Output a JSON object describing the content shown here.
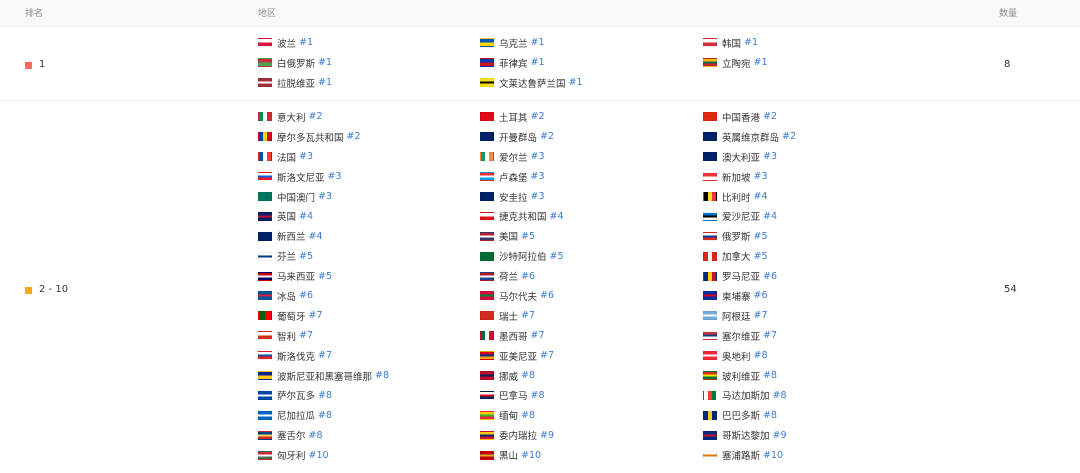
{
  "header": {
    "rank": "排名",
    "region": "地区",
    "count": "数量"
  },
  "groups": [
    {
      "rank_label": "1",
      "count": "8",
      "color": "#f26b5b",
      "regions": [
        {
          "name": "波兰",
          "rank": "#1",
          "flag": [
            "#ffffff",
            "#dc143c"
          ]
        },
        {
          "name": "乌克兰",
          "rank": "#1",
          "flag": [
            "#0057b7",
            "#ffd700"
          ]
        },
        {
          "name": "韩国",
          "rank": "#1",
          "flag": [
            "#ffffff",
            "#cd2e3a"
          ]
        },
        {
          "name": "白俄罗斯",
          "rank": "#1",
          "flag": [
            "#c8313e",
            "#4aa657"
          ]
        },
        {
          "name": "菲律宾",
          "rank": "#1",
          "flag": [
            "#0038a8",
            "#ce1126"
          ]
        },
        {
          "name": "立陶宛",
          "rank": "#1",
          "flag": [
            "#fdb913",
            "#006a44",
            "#c1272d"
          ]
        },
        {
          "name": "拉脱维亚",
          "rank": "#1",
          "flag": [
            "#9e3039",
            "#ffffff",
            "#9e3039"
          ]
        },
        {
          "name": "文莱达鲁萨兰国",
          "rank": "#1",
          "flag": [
            "#f7e017",
            "#000000",
            "#f7e017"
          ]
        }
      ]
    },
    {
      "rank_label": "2 - 10",
      "count": "54",
      "color": "#f5a623",
      "regions": [
        {
          "name": "意大利",
          "rank": "#2",
          "flag": [
            "#009246",
            "#ffffff",
            "#ce2b37"
          ],
          "vertical": true
        },
        {
          "name": "土耳其",
          "rank": "#2",
          "flag": [
            "#e30a17",
            "#e30a17"
          ]
        },
        {
          "name": "中国香港",
          "rank": "#2",
          "flag": [
            "#de2910",
            "#de2910"
          ]
        },
        {
          "name": "摩尔多瓦共和国",
          "rank": "#2",
          "flag": [
            "#0046ae",
            "#ffd200",
            "#cc092f"
          ],
          "vertical": true
        },
        {
          "name": "开曼群岛",
          "rank": "#2",
          "flag": [
            "#012169",
            "#012169"
          ]
        },
        {
          "name": "英属维京群岛",
          "rank": "#2",
          "flag": [
            "#012169",
            "#012169"
          ]
        },
        {
          "name": "法国",
          "rank": "#3",
          "flag": [
            "#0055a4",
            "#ffffff",
            "#ef4135"
          ],
          "vertical": true
        },
        {
          "name": "爱尔兰",
          "rank": "#3",
          "flag": [
            "#169b62",
            "#ffffff",
            "#ff883e"
          ],
          "vertical": true
        },
        {
          "name": "澳大利亚",
          "rank": "#3",
          "flag": [
            "#012169",
            "#012169"
          ]
        },
        {
          "name": "斯洛文尼亚",
          "rank": "#3",
          "flag": [
            "#ffffff",
            "#005ce5",
            "#ed1c24"
          ]
        },
        {
          "name": "卢森堡",
          "rank": "#3",
          "flag": [
            "#ed2939",
            "#ffffff",
            "#00a1de"
          ]
        },
        {
          "name": "新加坡",
          "rank": "#3",
          "flag": [
            "#ef3340",
            "#ffffff"
          ]
        },
        {
          "name": "中国澳门",
          "rank": "#3",
          "flag": [
            "#00785e",
            "#00785e"
          ]
        },
        {
          "name": "安圭拉",
          "rank": "#3",
          "flag": [
            "#012169",
            "#012169"
          ]
        },
        {
          "name": "比利时",
          "rank": "#4",
          "flag": [
            "#000000",
            "#fdda24",
            "#ef3340"
          ],
          "vertical": true
        },
        {
          "name": "英国",
          "rank": "#4",
          "flag": [
            "#012169",
            "#c8102e",
            "#012169"
          ]
        },
        {
          "name": "捷克共和国",
          "rank": "#4",
          "flag": [
            "#ffffff",
            "#d7141a"
          ]
        },
        {
          "name": "爱沙尼亚",
          "rank": "#4",
          "flag": [
            "#0072ce",
            "#000000",
            "#ffffff"
          ]
        },
        {
          "name": "新西兰",
          "rank": "#4",
          "flag": [
            "#012169",
            "#012169"
          ]
        },
        {
          "name": "美国",
          "rank": "#5",
          "flag": [
            "#b22234",
            "#ffffff",
            "#3c3b6e"
          ]
        },
        {
          "name": "俄罗斯",
          "rank": "#5",
          "flag": [
            "#ffffff",
            "#0039a6",
            "#d52b1e"
          ]
        },
        {
          "name": "芬兰",
          "rank": "#5",
          "flag": [
            "#ffffff",
            "#003580",
            "#ffffff"
          ]
        },
        {
          "name": "沙特阿拉伯",
          "rank": "#5",
          "flag": [
            "#006c35",
            "#006c35"
          ]
        },
        {
          "name": "加拿大",
          "rank": "#5",
          "flag": [
            "#d52b1e",
            "#ffffff",
            "#d52b1e"
          ],
          "vertical": true
        },
        {
          "name": "马来西亚",
          "rank": "#5",
          "flag": [
            "#cc0001",
            "#ffffff",
            "#010066"
          ]
        },
        {
          "name": "荷兰",
          "rank": "#6",
          "flag": [
            "#ae1c28",
            "#ffffff",
            "#21468b"
          ]
        },
        {
          "name": "罗马尼亚",
          "rank": "#6",
          "flag": [
            "#002b7f",
            "#fcd116",
            "#ce1126"
          ],
          "vertical": true
        },
        {
          "name": "冰岛",
          "rank": "#6",
          "flag": [
            "#02529c",
            "#dc1e35",
            "#02529c"
          ]
        },
        {
          "name": "马尔代夫",
          "rank": "#6",
          "flag": [
            "#d21034",
            "#007e3a",
            "#d21034"
          ]
        },
        {
          "name": "柬埔寨",
          "rank": "#6",
          "flag": [
            "#032ea1",
            "#e00025",
            "#032ea1"
          ]
        },
        {
          "name": "葡萄牙",
          "rank": "#7",
          "flag": [
            "#006600",
            "#ff0000"
          ],
          "vertical": true
        },
        {
          "name": "瑞士",
          "rank": "#7",
          "flag": [
            "#d52b1e",
            "#d52b1e"
          ]
        },
        {
          "name": "阿根廷",
          "rank": "#7",
          "flag": [
            "#74acdf",
            "#ffffff",
            "#74acdf"
          ]
        },
        {
          "name": "智利",
          "rank": "#7",
          "flag": [
            "#ffffff",
            "#d52b1e"
          ]
        },
        {
          "name": "墨西哥",
          "rank": "#7",
          "flag": [
            "#006847",
            "#ffffff",
            "#ce1126"
          ],
          "vertical": true
        },
        {
          "name": "塞尔维亚",
          "rank": "#7",
          "flag": [
            "#c6363c",
            "#0c4076",
            "#ffffff"
          ]
        },
        {
          "name": "斯洛伐克",
          "rank": "#7",
          "flag": [
            "#ffffff",
            "#0b4ea2",
            "#ee1c25"
          ]
        },
        {
          "name": "亚美尼亚",
          "rank": "#7",
          "flag": [
            "#d90012",
            "#0033a0",
            "#f2a800"
          ]
        },
        {
          "name": "奥地利",
          "rank": "#8",
          "flag": [
            "#ed2939",
            "#ffffff",
            "#ed2939"
          ]
        },
        {
          "name": "波斯尼亚和黑塞哥维那",
          "rank": "#8",
          "flag": [
            "#002395",
            "#fecb00"
          ]
        },
        {
          "name": "挪威",
          "rank": "#8",
          "flag": [
            "#ba0c2f",
            "#00205b",
            "#ba0c2f"
          ]
        },
        {
          "name": "玻利维亚",
          "rank": "#8",
          "flag": [
            "#d52b1e",
            "#f9e300",
            "#007934"
          ]
        },
        {
          "name": "萨尔瓦多",
          "rank": "#8",
          "flag": [
            "#0047ab",
            "#ffffff",
            "#0047ab"
          ]
        },
        {
          "name": "巴拿马",
          "rank": "#8",
          "flag": [
            "#ffffff",
            "#da121a",
            "#072357"
          ]
        },
        {
          "name": "马达加斯加",
          "rank": "#8",
          "flag": [
            "#ffffff",
            "#fc3d32",
            "#007e3a"
          ],
          "vertical": true
        },
        {
          "name": "尼加拉瓜",
          "rank": "#8",
          "flag": [
            "#0067c6",
            "#ffffff",
            "#0067c6"
          ]
        },
        {
          "name": "缅甸",
          "rank": "#8",
          "flag": [
            "#fecb00",
            "#34b233",
            "#ea2839"
          ]
        },
        {
          "name": "巴巴多斯",
          "rank": "#8",
          "flag": [
            "#00267f",
            "#ffc726",
            "#00267f"
          ],
          "vertical": true
        },
        {
          "name": "塞舌尔",
          "rank": "#8",
          "flag": [
            "#003f87",
            "#fcd856",
            "#d62828"
          ]
        },
        {
          "name": "委内瑞拉",
          "rank": "#9",
          "flag": [
            "#ffcc00",
            "#00247d",
            "#cf142b"
          ]
        },
        {
          "name": "哥斯达黎加",
          "rank": "#9",
          "flag": [
            "#002b7f",
            "#ce1126",
            "#002b7f"
          ]
        },
        {
          "name": "匈牙利",
          "rank": "#10",
          "flag": [
            "#ce2939",
            "#ffffff",
            "#477050"
          ]
        },
        {
          "name": "黑山",
          "rank": "#10",
          "flag": [
            "#c40308",
            "#d4af37",
            "#c40308"
          ]
        },
        {
          "name": "塞浦路斯",
          "rank": "#10",
          "flag": [
            "#ffffff",
            "#d57800",
            "#ffffff"
          ]
        }
      ]
    }
  ]
}
